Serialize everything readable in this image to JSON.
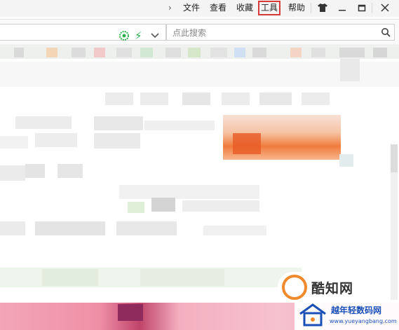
{
  "menu": {
    "expand_glyph": "›",
    "items": [
      "文件",
      "查看",
      "收藏",
      "工具",
      "帮助"
    ],
    "active_index": 3
  },
  "window_controls": {
    "skin": "skin-icon",
    "minimize": "minimize-icon",
    "maximize": "maximize-icon",
    "close": "close-icon"
  },
  "address_bar": {
    "security_icon": "green-site-icon",
    "accelerate_icon": "lightning-icon",
    "dropdown_icon": "chevron-down-icon"
  },
  "search": {
    "placeholder": "点此搜索",
    "icon": "search-icon"
  },
  "watermark": {
    "logo_text": "酷知网",
    "badge_text": "越年轻数码网",
    "badge_url": "www.yueyangbang.com"
  },
  "colors": {
    "active_outline": "#d83a3a",
    "bolt": "#2bb24c",
    "watermark_orange": "#f08a2c",
    "watermark_blue": "#1a4fb8"
  }
}
